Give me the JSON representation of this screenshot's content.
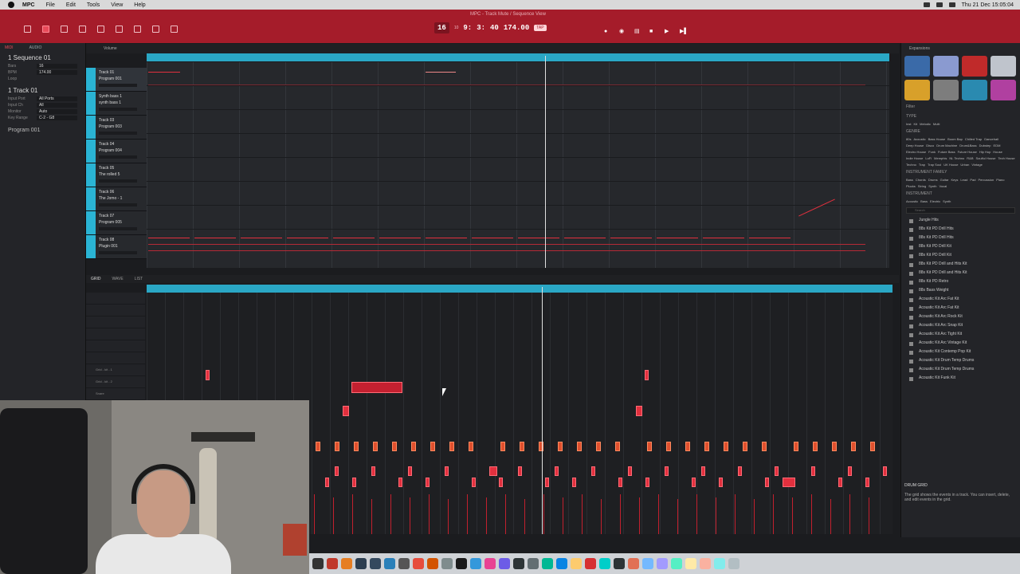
{
  "menubar": {
    "app_name": "MPC",
    "items": [
      "File",
      "Edit",
      "Tools",
      "View",
      "Help"
    ],
    "clock": "Thu 21 Dec  15:05:04"
  },
  "header": {
    "window_title": "MPC - Track Mute / Sequence View",
    "bars_value": "9:",
    "beats_value": "3:",
    "ticks_value": "40",
    "tempo_value": "174.00",
    "tap_label": "TAP",
    "seq_number": "16",
    "seq_sub": "10"
  },
  "left": {
    "tab_midi": "MIDI",
    "tab_audio": "AUDIO",
    "sequence_label": "1 Sequence 01",
    "bars_label": "Bars",
    "bars_value": "16",
    "bpm_label": "BPM",
    "bpm_value": "174.00",
    "loop_label": "Loop",
    "track_label": "1 Track 01",
    "input_port_label": "Input Port",
    "input_port_value": "All Ports",
    "input_ch_label": "Input Ch",
    "input_ch_value": "All",
    "monitor_label": "Monitor",
    "monitor_value": "Auto",
    "key_range_label": "Key Range",
    "key_range_value": "C-2 - G8",
    "program_label": "Program 001"
  },
  "seq_toolbar": {
    "view_mode": "Volume"
  },
  "tracks": [
    {
      "name": "Track 01",
      "program": "Program 001"
    },
    {
      "name": "Synth bass 1",
      "program": "synth bass 1"
    },
    {
      "name": "Track 03",
      "program": "Program 003"
    },
    {
      "name": "Track 04",
      "program": "Program 004"
    },
    {
      "name": "Track 05",
      "program": "The rolled 5"
    },
    {
      "name": "Track 06",
      "program": "The Jomo - 1"
    },
    {
      "name": "Track 07",
      "program": "Program 005"
    },
    {
      "name": "Track 08",
      "program": "Plugin 001"
    }
  ],
  "grid_toolbar": {
    "tab_grid": "GRID",
    "tab_wave": "WAVE",
    "tab_list": "LIST"
  },
  "pads": [
    "",
    "",
    "",
    "",
    "",
    "",
    "Grid - kit - 1",
    "Grid - kit - 2",
    "Snare"
  ],
  "right": {
    "expansions_title": "Expansions",
    "filter_title": "Filter",
    "type_label": "TYPE",
    "types": [
      "Inst",
      "Kit",
      "Melodic",
      "Multi"
    ],
    "genre_label": "GENRE",
    "genres": [
      "80s",
      "Acoustic",
      "Bass House",
      "Boom Bap",
      "Chilled Trap",
      "Dancehall",
      "Deep House",
      "Disco",
      "Drum Machine",
      "Drum&Bass",
      "Dubstep",
      "EDM",
      "Electro House",
      "Funk",
      "Future Bass",
      "Future House",
      "Hip Hop",
      "House",
      "Indie House",
      "LoFi",
      "Memphis",
      "NL Techno",
      "R&B",
      "Soulful House",
      "Tech House",
      "Techno",
      "Trap",
      "Trap Soul",
      "UK House",
      "Urban",
      "Vintage"
    ],
    "family_label": "INSTRUMENT FAMILY",
    "families": [
      "Bass",
      "Chords",
      "Drums",
      "Guitar",
      "Keys",
      "Lead",
      "Pad",
      "Percussion",
      "Piano",
      "Plucks",
      "String",
      "Synth",
      "Vocal"
    ],
    "instrument_label": "INSTRUMENT",
    "instruments": [
      "Acoustic",
      "Bass",
      "Electric",
      "Synth"
    ],
    "search_placeholder": "Search",
    "files": [
      "Jungle Hits",
      "88s Kit PD Drill Hits",
      "88s Kit PD Drill Hits",
      "88s Kit PD Drill Kit",
      "88s Kit PD Drill Kit",
      "88s Kit PD Drill and Hits Kit",
      "88s Kit PD Drill and Hits Kit",
      "88s Kit PD Retro",
      "88s Bass Weight",
      "Acoustic Kit Arc Fat Kit",
      "Acoustic Kit Arc Fat Kit",
      "Acoustic Kit Arc Rock Kit",
      "Acoustic Kit Arc Snap Kit",
      "Acoustic Kit Arc Tight Kit",
      "Acoustic Kit Arc Vintage Kit",
      "Acoustic Kit Contemp Pop Kit",
      "Acoustic Kit Drum Temp Drums",
      "Acoustic Kit Drum Temp Drums",
      "Acoustic Kit Funk Kit"
    ],
    "help_title": "DRUM GRID",
    "help_text": "The grid shows the events in a track. You can insert, delete, and edit events in the grid."
  },
  "colors": {
    "brand_red": "#a51c2a",
    "accent_cyan": "#2aa7c5",
    "note_red": "#e2303e"
  }
}
